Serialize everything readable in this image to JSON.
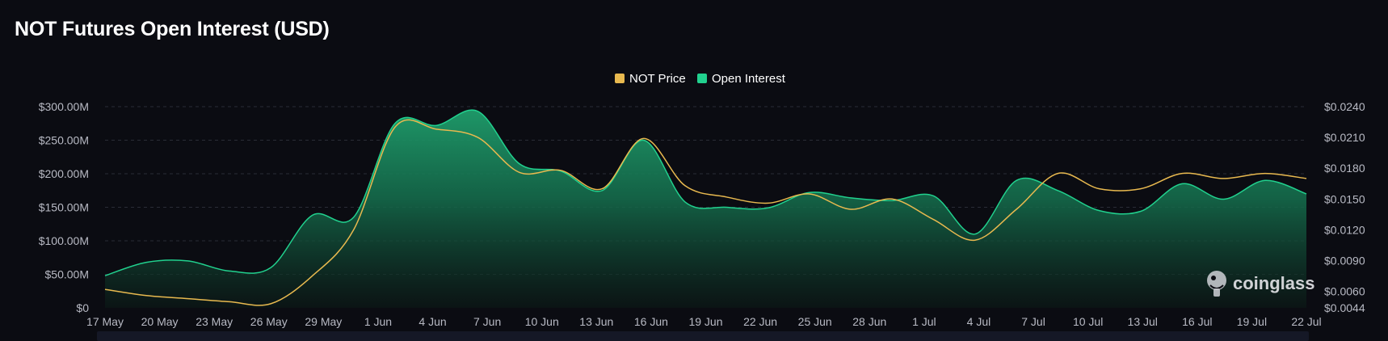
{
  "title": "NOT Futures Open Interest (USD)",
  "watermark": "coinglass",
  "colors": {
    "price": "#e8b94f",
    "oi_fill": "#1ea672",
    "oi_line": "#21d18e",
    "grid": "#2a2c36"
  },
  "chart_data": {
    "type": "area",
    "x": [
      "17 May",
      "20 May",
      "23 May",
      "26 May",
      "29 May",
      "1 Jun",
      "4 Jun",
      "7 Jun",
      "10 Jun",
      "13 Jun",
      "16 Jun",
      "19 Jun",
      "22 Jun",
      "25 Jun",
      "28 Jun",
      "1 Jul",
      "4 Jul",
      "7 Jul",
      "10 Jul",
      "13 Jul",
      "16 Jul",
      "19 Jul",
      "22 Jul"
    ],
    "series": [
      {
        "name": "Open Interest",
        "axis": "left",
        "values": [
          48,
          68,
          70,
          55,
          60,
          138,
          135,
          275,
          272,
          293,
          215,
          204,
          175,
          250,
          158,
          150,
          149,
          172,
          164,
          160,
          167,
          110,
          190,
          175,
          145,
          144,
          185,
          162,
          190,
          170
        ]
      },
      {
        "name": "NOT Price",
        "axis": "right",
        "values": [
          0.0062,
          0.0056,
          0.0053,
          0.005,
          0.0048,
          0.0075,
          0.012,
          0.022,
          0.0218,
          0.021,
          0.0176,
          0.0178,
          0.016,
          0.0209,
          0.0163,
          0.0152,
          0.0146,
          0.0155,
          0.014,
          0.015,
          0.013,
          0.011,
          0.014,
          0.0175,
          0.016,
          0.016,
          0.0175,
          0.017,
          0.0175,
          0.017
        ]
      }
    ],
    "left_axis": {
      "ticks": [
        "$0",
        "$50.00M",
        "$100.00M",
        "$150.00M",
        "$200.00M",
        "$250.00M",
        "$300.00M"
      ],
      "ylim": [
        0,
        300
      ]
    },
    "right_axis": {
      "ticks": [
        "$0.0044",
        "$0.0060",
        "$0.0090",
        "$0.0120",
        "$0.0150",
        "$0.0180",
        "$0.0210",
        "$0.0240"
      ],
      "ylim": [
        0.0044,
        0.024
      ]
    },
    "legend": [
      "NOT Price",
      "Open Interest"
    ],
    "legend_position": "top-center",
    "grid": true
  }
}
